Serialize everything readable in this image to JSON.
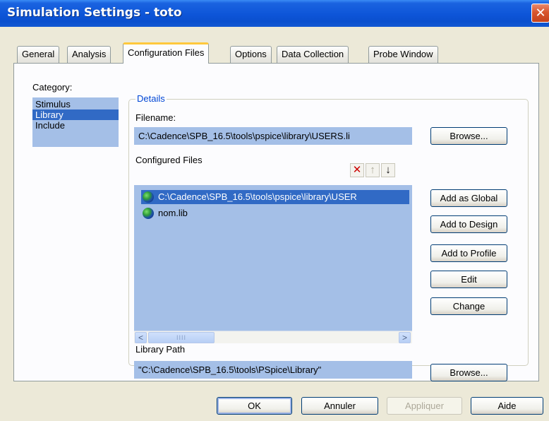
{
  "window": {
    "title": "Simulation Settings - toto",
    "close_glyph": "✕"
  },
  "tabs": [
    {
      "label": "General"
    },
    {
      "label": "Analysis"
    },
    {
      "label": "Configuration Files",
      "active": true
    },
    {
      "label": "Options"
    },
    {
      "label": "Data Collection"
    },
    {
      "label": "Probe Window"
    }
  ],
  "category": {
    "label": "Category:",
    "items": [
      "Stimulus",
      "Library",
      "Include"
    ],
    "selected": "Library"
  },
  "details": {
    "legend": "Details",
    "filename_label": "Filename:",
    "filename_value": "C:\\Cadence\\SPB_16.5\\tools\\pspice\\library\\USERS.li",
    "browse_label": "Browse...",
    "configured_files_label": "Configured Files",
    "toolbar": {
      "delete_glyph": "✕",
      "up_glyph": "↑",
      "down_glyph": "↓"
    },
    "files": [
      {
        "name": "C:\\Cadence\\SPB_16.5\\tools\\pspice\\library\\USER",
        "icon": "globe-icon",
        "selected": true
      },
      {
        "name": "nom.lib",
        "icon": "globe-icon",
        "selected": false
      }
    ],
    "scroll": {
      "left": "<",
      "right": ">",
      "thumb_grip": "IIII"
    },
    "actions": {
      "add_global": "Add as Global",
      "add_design": "Add to Design",
      "add_profile": "Add to Profile",
      "edit": "Edit",
      "change": "Change"
    },
    "library_path_label": "Library Path",
    "library_path_value": "\"C:\\Cadence\\SPB_16.5\\tools\\PSpice\\Library\"",
    "browse2_label": "Browse..."
  },
  "footer": {
    "ok": "OK",
    "cancel": "Annuler",
    "apply": "Appliquer",
    "help": "Aide"
  },
  "colors": {
    "title_bar": "#0d55d8",
    "list_bg": "#a4bfe7",
    "selection": "#316ac5",
    "tab_highlight": "#ffc83c",
    "delete_icon": "#cc0000"
  }
}
